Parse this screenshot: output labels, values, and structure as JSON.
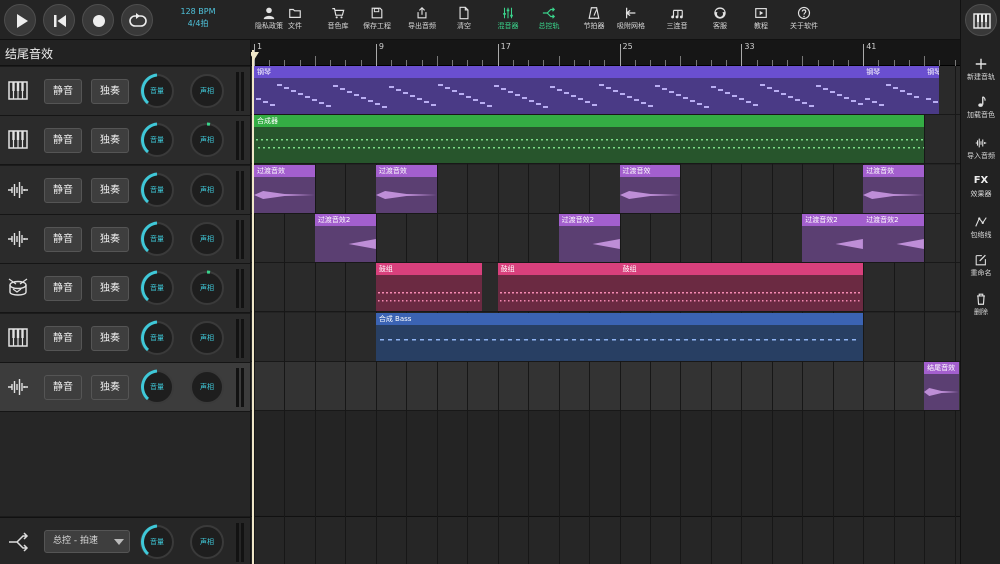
{
  "transport": {
    "tempo": "128 BPM",
    "time_signature": "4/4拍"
  },
  "toolbar": {
    "items": [
      {
        "label": "隐私政策",
        "icon": "person-icon"
      },
      {
        "label": "文件",
        "icon": "folder-icon"
      },
      {
        "label": "音色库",
        "icon": "cart-icon"
      },
      {
        "label": "保存工程",
        "icon": "save-icon"
      },
      {
        "label": "导出音频",
        "icon": "export-icon"
      },
      {
        "label": "清空",
        "icon": "document-icon"
      },
      {
        "label": "混音器",
        "icon": "mixer-icon"
      },
      {
        "label": "总控轨",
        "icon": "master-track-icon"
      },
      {
        "label": "节拍器",
        "icon": "metronome-icon"
      },
      {
        "label": "吸附网格",
        "icon": "snap-grid-icon"
      },
      {
        "label": "三连音",
        "icon": "triplet-icon"
      },
      {
        "label": "客服",
        "icon": "support-icon"
      },
      {
        "label": "教程",
        "icon": "tutorial-icon"
      },
      {
        "label": "关于软件",
        "icon": "help-icon"
      }
    ],
    "active_color": "#3ad48c"
  },
  "project": {
    "title": "结尾音效"
  },
  "labels": {
    "mute": "静音",
    "solo": "独奏",
    "volume": "音量",
    "pan": "声相"
  },
  "tracks": [
    {
      "icon": "piano-icon"
    },
    {
      "icon": "piano-icon"
    },
    {
      "icon": "waveform-icon"
    },
    {
      "icon": "waveform-icon"
    },
    {
      "icon": "drum-icon"
    },
    {
      "icon": "piano-icon"
    },
    {
      "icon": "waveform-icon",
      "selected": true
    }
  ],
  "master": {
    "selector": "总控 - 拍速",
    "icon": "master-track-icon"
  },
  "timeline": {
    "bar_numbers": [
      "1",
      "9",
      "17",
      "25",
      "33",
      "41"
    ],
    "clips": [
      {
        "track": 1,
        "bar_start": 1,
        "bar_end": 41,
        "label": "钢琴",
        "color": "purple"
      },
      {
        "track": 1,
        "bar_start": 41,
        "bar_end": 45,
        "label": "钢琴",
        "color": "purple"
      },
      {
        "track": 1,
        "bar_start": 45,
        "bar_end": 46,
        "label": "钢琴",
        "color": "purple"
      },
      {
        "track": 2,
        "bar_start": 1,
        "bar_end": 45,
        "label": "合成器",
        "color": "green"
      },
      {
        "track": 3,
        "bar_start": 1,
        "bar_end": 5,
        "label": "过渡音效",
        "color": "violet"
      },
      {
        "track": 3,
        "bar_start": 9,
        "bar_end": 13,
        "label": "过渡音效",
        "color": "violet"
      },
      {
        "track": 3,
        "bar_start": 25,
        "bar_end": 29,
        "label": "过渡音效",
        "color": "violet"
      },
      {
        "track": 3,
        "bar_start": 41,
        "bar_end": 45,
        "label": "过渡音效",
        "color": "violet"
      },
      {
        "track": 4,
        "bar_start": 5,
        "bar_end": 9,
        "label": "过渡音效2",
        "color": "violet"
      },
      {
        "track": 4,
        "bar_start": 21,
        "bar_end": 25,
        "label": "过渡音效2",
        "color": "violet"
      },
      {
        "track": 4,
        "bar_start": 37,
        "bar_end": 41,
        "label": "过渡音效2",
        "color": "violet"
      },
      {
        "track": 4,
        "bar_start": 41,
        "bar_end": 45,
        "label": "过渡音效2",
        "color": "violet"
      },
      {
        "track": 5,
        "bar_start": 9,
        "bar_end": 16,
        "label": "鼓组",
        "color": "pink"
      },
      {
        "track": 5,
        "bar_start": 17,
        "bar_end": 25,
        "label": "鼓组",
        "color": "pink"
      },
      {
        "track": 5,
        "bar_start": 25,
        "bar_end": 41,
        "label": "鼓组",
        "color": "pink"
      },
      {
        "track": 6,
        "bar_start": 9,
        "bar_end": 41,
        "label": "合成 Bass",
        "color": "blue"
      },
      {
        "track": 7,
        "bar_start": 45,
        "bar_end": 47.3,
        "label": "结尾音效",
        "color": "violet"
      }
    ]
  },
  "right_panel": {
    "items": [
      {
        "label": "新建音轨",
        "icon": "plus-icon"
      },
      {
        "label": "加载音色",
        "icon": "music-note-icon"
      },
      {
        "label": "导入音频",
        "icon": "import-audio-icon"
      },
      {
        "label": "效果器",
        "icon_text": "FX"
      },
      {
        "label": "包络线",
        "icon": "envelope-icon"
      },
      {
        "label": "重命名",
        "icon": "edit-icon"
      },
      {
        "label": "删除",
        "icon": "trash-icon"
      }
    ]
  },
  "colors": {
    "purple": "#6a4fd0",
    "green": "#34ad44",
    "violet": "#a35fce",
    "pink": "#d8407c",
    "blue": "#3b63b3",
    "accent": "#3fc8d8"
  }
}
